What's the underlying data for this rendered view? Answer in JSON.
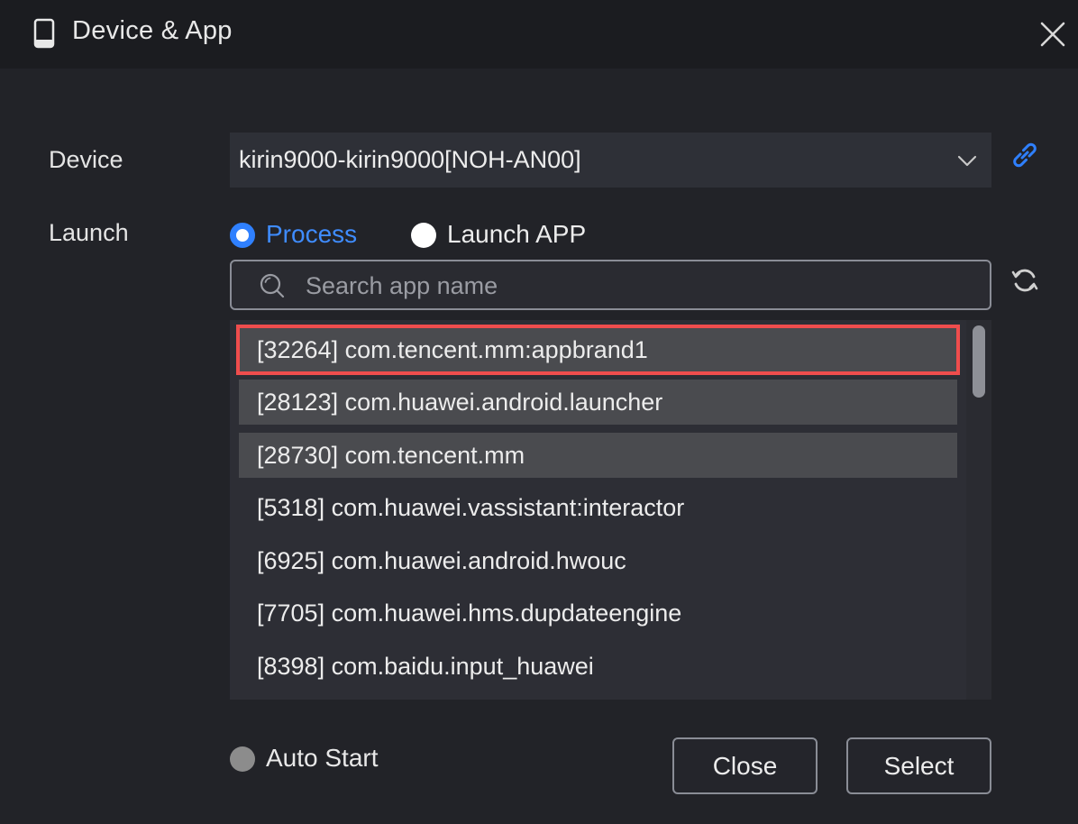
{
  "dialog": {
    "title": "Device & App",
    "title_icon": "phone-icon",
    "close_icon": "close-icon"
  },
  "device": {
    "label": "Device",
    "selected": "kirin9000-kirin9000[NOH-AN00]",
    "dropdown_icon": "chevron-down-icon",
    "link_icon": "link-icon"
  },
  "launch": {
    "label": "Launch",
    "options": [
      {
        "label": "Process",
        "selected": true
      },
      {
        "label": "Launch APP",
        "selected": false
      }
    ]
  },
  "search": {
    "placeholder": "Search app name",
    "icon": "search-icon",
    "refresh_icon": "refresh-icon"
  },
  "process_list": [
    {
      "text": "[32264] com.tencent.mm:appbrand1",
      "highlighted": true,
      "selected": true
    },
    {
      "text": "[28123] com.huawei.android.launcher",
      "highlighted": true,
      "selected": false
    },
    {
      "text": "[28730] com.tencent.mm",
      "highlighted": true,
      "selected": false
    },
    {
      "text": "[5318] com.huawei.vassistant:interactor",
      "highlighted": false,
      "selected": false
    },
    {
      "text": "[6925] com.huawei.android.hwouc",
      "highlighted": false,
      "selected": false
    },
    {
      "text": "[7705] com.huawei.hms.dupdateengine",
      "highlighted": false,
      "selected": false
    },
    {
      "text": "[8398] com.baidu.input_huawei",
      "highlighted": false,
      "selected": false
    }
  ],
  "auto_start": {
    "label": "Auto Start",
    "checked": false
  },
  "buttons": {
    "close": "Close",
    "select": "Select"
  },
  "colors": {
    "accent": "#2f80ff",
    "selection_outline": "#ef4d4d",
    "background": "#222328"
  }
}
